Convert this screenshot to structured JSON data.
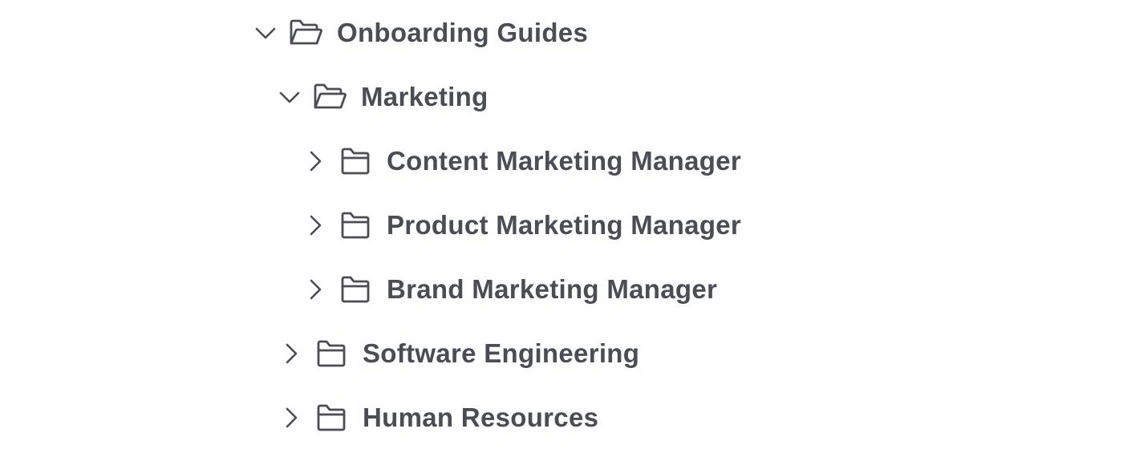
{
  "tree": {
    "root": {
      "label": "Onboarding Guides",
      "expanded": true,
      "icon": "folder-open-icon",
      "chevron": "chevron-down-icon"
    },
    "marketing": {
      "label": "Marketing",
      "expanded": true,
      "icon": "folder-open-icon",
      "chevron": "chevron-down-icon",
      "children": [
        {
          "label": "Content Marketing Manager",
          "expanded": false,
          "icon": "folder-icon",
          "chevron": "chevron-right-icon"
        },
        {
          "label": "Product Marketing Manager",
          "expanded": false,
          "icon": "folder-icon",
          "chevron": "chevron-right-icon"
        },
        {
          "label": "Brand Marketing Manager",
          "expanded": false,
          "icon": "folder-icon",
          "chevron": "chevron-right-icon"
        }
      ]
    },
    "siblings": [
      {
        "label": "Software Engineering",
        "expanded": false,
        "icon": "folder-icon",
        "chevron": "chevron-right-icon"
      },
      {
        "label": "Human Resources",
        "expanded": false,
        "icon": "folder-icon",
        "chevron": "chevron-right-icon"
      }
    ]
  },
  "colors": {
    "text": "#4a4d54",
    "icon": "#4a4d54",
    "background": "#ffffff"
  }
}
